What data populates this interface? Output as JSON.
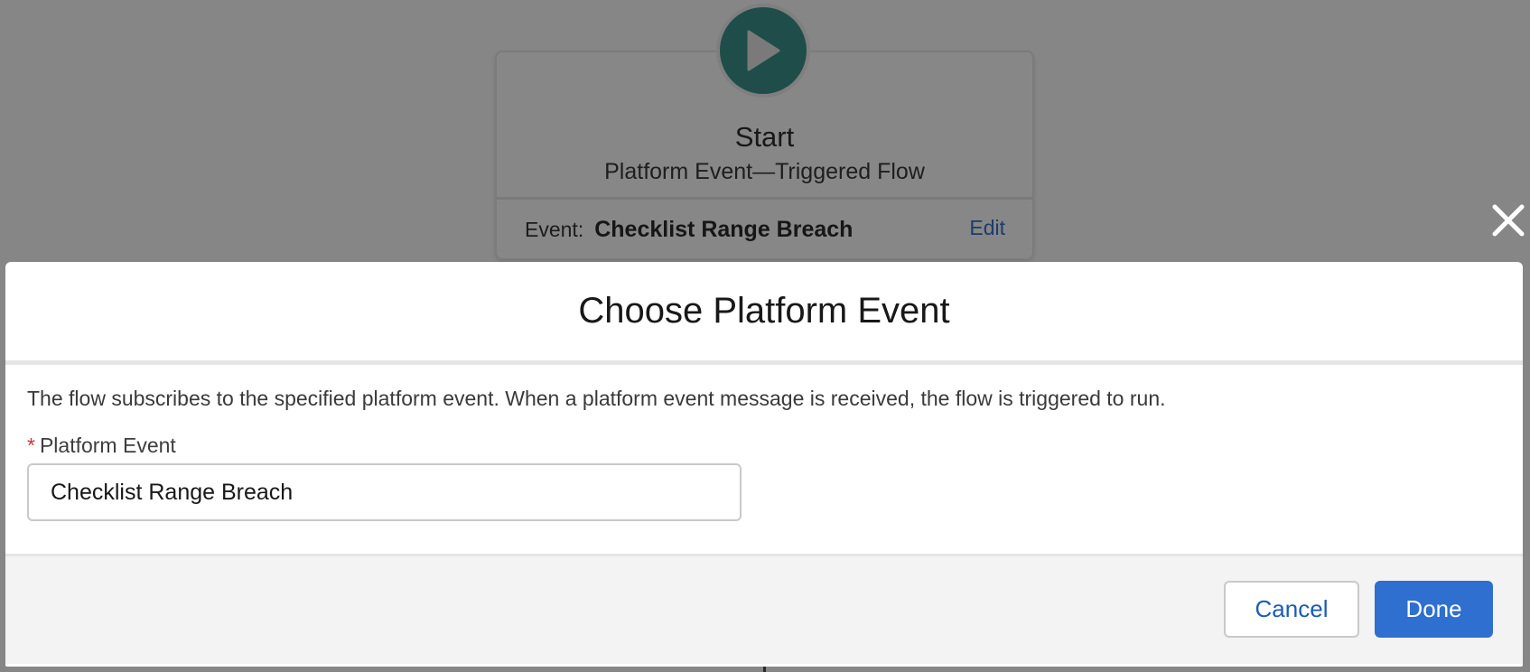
{
  "canvas": {
    "start_node": {
      "title": "Start",
      "subtitle": "Platform Event—Triggered Flow",
      "event_label": "Event:",
      "event_value": "Checklist Range Breach",
      "edit_label": "Edit",
      "icon": "play-icon"
    },
    "close_icon": "close-icon"
  },
  "modal": {
    "title": "Choose Platform Event",
    "description": "The flow subscribes to the specified platform event. When a platform event message is received, the flow is triggered to run.",
    "field": {
      "required_marker": "*",
      "label": "Platform Event",
      "value": "Checklist Range Breach"
    },
    "footer": {
      "cancel_label": "Cancel",
      "done_label": "Done"
    }
  },
  "colors": {
    "overlay": "#868686",
    "start_circle": "#1f4d4a",
    "primary_button": "#2e6fcf",
    "link": "#1b5bb8",
    "required": "#c23934"
  }
}
